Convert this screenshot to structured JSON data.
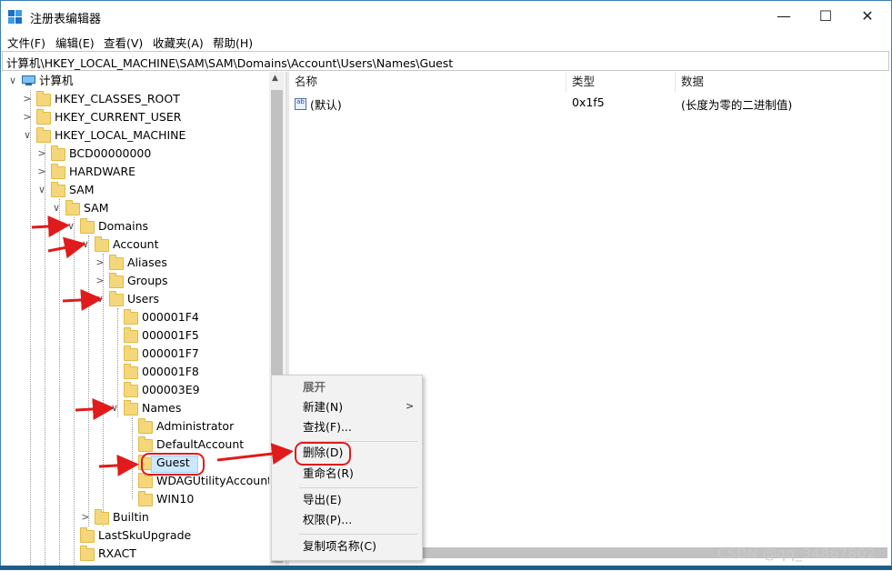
{
  "window": {
    "title": "注册表编辑器",
    "minimize": "—",
    "maximize": "☐",
    "close": "✕"
  },
  "menu": [
    "文件(F)",
    "编辑(E)",
    "查看(V)",
    "收藏夹(A)",
    "帮助(H)"
  ],
  "address": "计算机\\HKEY_LOCAL_MACHINE\\SAM\\SAM\\Domains\\Account\\Users\\Names\\Guest",
  "tree": [
    {
      "label": "计算机",
      "chev": "∨"
    },
    {
      "label": "HKEY_CLASSES_ROOT",
      "chev": ">"
    },
    {
      "label": "HKEY_CURRENT_USER",
      "chev": ">"
    },
    {
      "label": "HKEY_LOCAL_MACHINE",
      "chev": "∨"
    },
    {
      "label": "BCD00000000",
      "chev": ">"
    },
    {
      "label": "HARDWARE",
      "chev": ">"
    },
    {
      "label": "SAM",
      "chev": "∨"
    },
    {
      "label": "SAM",
      "chev": "∨"
    },
    {
      "label": "Domains",
      "chev": "∨"
    },
    {
      "label": "Account",
      "chev": "∨"
    },
    {
      "label": "Aliases",
      "chev": ">"
    },
    {
      "label": "Groups",
      "chev": ">"
    },
    {
      "label": "Users",
      "chev": "∨"
    },
    {
      "label": "000001F4",
      "chev": ""
    },
    {
      "label": "000001F5",
      "chev": ""
    },
    {
      "label": "000001F7",
      "chev": ""
    },
    {
      "label": "000001F8",
      "chev": ""
    },
    {
      "label": "000003E9",
      "chev": ""
    },
    {
      "label": "Names",
      "chev": "∨"
    },
    {
      "label": "Administrator",
      "chev": ""
    },
    {
      "label": "DefaultAccount",
      "chev": ""
    },
    {
      "label": "Guest",
      "chev": ""
    },
    {
      "label": "WDAGUtilityAccount",
      "chev": ""
    },
    {
      "label": "WIN10",
      "chev": ""
    },
    {
      "label": "Builtin",
      "chev": ">"
    },
    {
      "label": "LastSkuUpgrade",
      "chev": ""
    },
    {
      "label": "RXACT",
      "chev": ""
    }
  ],
  "list": {
    "headers": {
      "name": "名称",
      "type": "类型",
      "data": "数据"
    },
    "rows": [
      {
        "name": "(默认)",
        "type": "0x1f5",
        "data": "(长度为零的二进制值)",
        "icon": "ab"
      }
    ]
  },
  "context_menu": {
    "items": [
      "展开",
      "新建(N)",
      "查找(F)...",
      "删除(D)",
      "重命名(R)",
      "导出(E)",
      "权限(P)...",
      "复制项名称(C)"
    ],
    "submenu_arrow": ">"
  },
  "watermark": "CSDN @qq_34867802",
  "colors": {
    "annotation_red": "#e01b1b",
    "selection": "#cce8ff",
    "folder": "#f4d77a"
  }
}
